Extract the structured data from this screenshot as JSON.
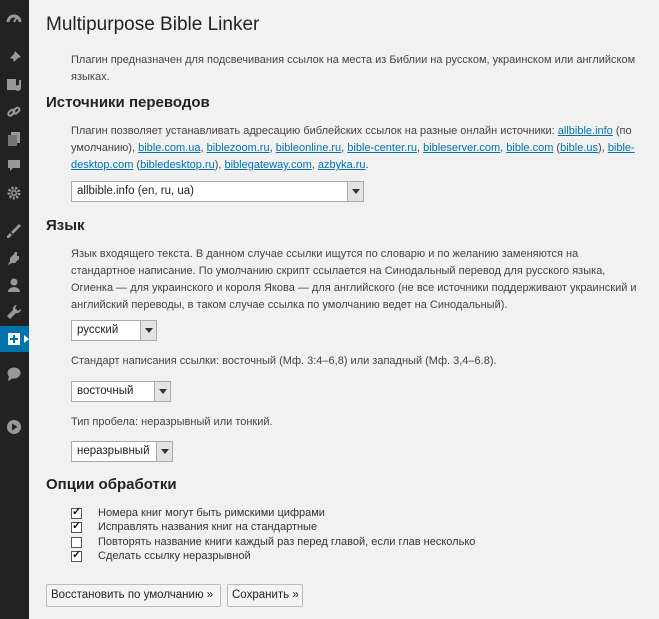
{
  "sidebar": {
    "icons": [
      "dashboard-icon",
      "pin-icon",
      "media-icon",
      "links-icon",
      "pages-icon",
      "comments-icon",
      "settings-gear-icon",
      "appearance-icon",
      "plugins-icon",
      "users-icon",
      "tools-icon",
      "bible-linker-icon",
      "speech-bubble-icon",
      "play-icon"
    ]
  },
  "page": {
    "title": "Multipurpose Bible Linker",
    "intro": "Плагин предназначен для подсвечивания ссылок на места из Библии на русском, украинском или английском языках."
  },
  "sources": {
    "heading": "Источники переводов",
    "text_before": "Плагин позволяет устанавливать адресацию библейских ссылок на разные онлайн источники: ",
    "links": [
      "allbible.info",
      "bible.com.ua",
      "biblezoom.ru",
      "bibleonline.ru",
      "bible-center.ru",
      "bibleserver.com",
      "bible.com",
      "bible.us",
      "bible-desktop.com",
      "bibledesktop.ru",
      "biblegateway.com",
      "azbyka.ru"
    ],
    "default_note": "(по умолчанию)",
    "select_value": "allbible.info (en, ru, ua)"
  },
  "language": {
    "heading": "Язык",
    "description": "Язык входящего текста. В данном случае ссылки ищутся по словарю и по желанию заменяются на стандартное написание. По умолчанию скрипт ссылается на Синодальный перевод для русского языка, Огиенка — для украинского и короля Якова — для английского (не все источники поддерживают украинский и английский переводы, в таком случае ссылка по умолчанию ведет на Синодальный).",
    "select_value": "русский",
    "link_style_text": "Стандарт написания ссылки: восточный (Мф. 3:4–6,8) или западный (Мф. 3,4–6.8).",
    "link_style_value": "восточный",
    "space_text": "Тип пробела: неразрывный или тонкий.",
    "space_value": "неразрывный"
  },
  "options": {
    "heading": "Опции обработки",
    "items": [
      {
        "label": "Номера книг могут быть римскими цифрами",
        "checked": true
      },
      {
        "label": "Исправлять названия книг на стандартные",
        "checked": true
      },
      {
        "label": "Повторять название книги каждый раз перед главой, если глав несколько",
        "checked": false
      },
      {
        "label": "Сделать ссылку неразрывной",
        "checked": true
      }
    ]
  },
  "buttons": {
    "reset": "Восстановить по умолчанию »",
    "save": "Сохранить »"
  }
}
